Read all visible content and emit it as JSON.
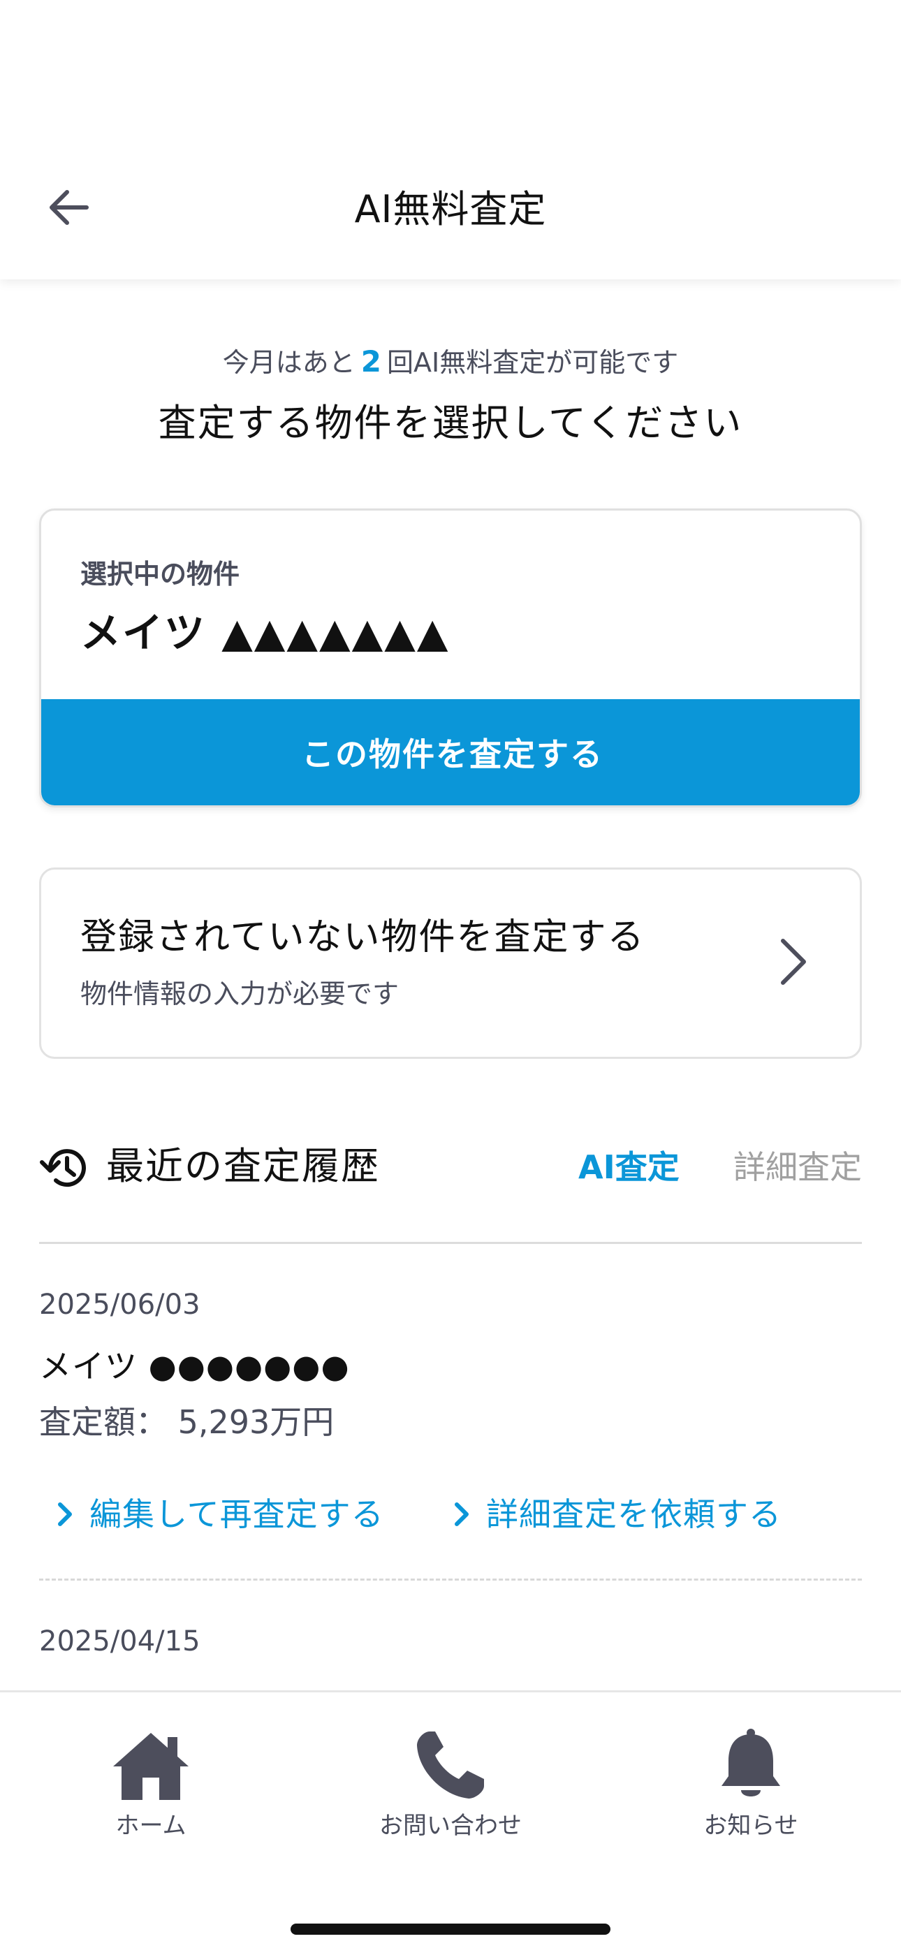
{
  "header": {
    "title": "AI無料査定"
  },
  "intro": {
    "note_prefix": "今月はあと",
    "remaining_count": "2",
    "note_suffix": "回AI無料査定が可能です",
    "instruction": "査定する物件を選択してください"
  },
  "selected_property": {
    "label": "選択中の物件",
    "name": "メイツ ▲▲▲▲▲▲▲",
    "action_label": "この物件を査定する"
  },
  "unregistered": {
    "title": "登録されていない物件を査定する",
    "subtitle": "物件情報の入力が必要です"
  },
  "history": {
    "title": "最近の査定履歴",
    "tabs": [
      "AI査定",
      "詳細査定"
    ],
    "active_tab": "AI査定",
    "entries": [
      {
        "date": "2025/06/03",
        "name": "メイツ ●●●●●●●",
        "price": "査定額： 5,293万円",
        "links": [
          "編集して再査定する",
          "詳細査定を依頼する"
        ]
      },
      {
        "date": "2025/04/15"
      }
    ]
  },
  "bottom_nav": [
    {
      "label": "ホーム",
      "icon": "home-icon"
    },
    {
      "label": "お問い合わせ",
      "icon": "phone-icon"
    },
    {
      "label": "お知らせ",
      "icon": "bell-icon"
    }
  ],
  "colors": {
    "accent": "#0b96d8",
    "text_primary": "#111111",
    "text_secondary": "#4a4d5c",
    "tab_inactive": "#a0a0a0",
    "nav_icon": "#4d4e5c"
  }
}
